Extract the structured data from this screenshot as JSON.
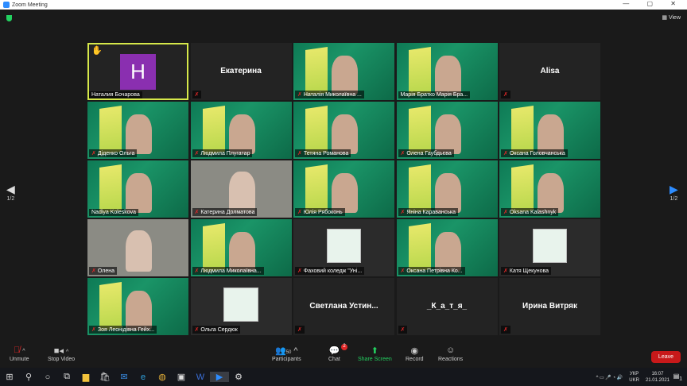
{
  "window": {
    "title": "Zoom Meeting",
    "controls": "— ▢ ✕"
  },
  "view_label": "View",
  "pager": {
    "left": "1/2",
    "right": "1/2"
  },
  "tiles": [
    {
      "name": "Наталия Бочарова",
      "type": "avatar",
      "initial": "H",
      "active": true,
      "hand": true,
      "muted": false
    },
    {
      "name": "Екатерина",
      "type": "nameonly",
      "muted": true
    },
    {
      "name": "Наталія Миколаївна ...",
      "type": "video",
      "muted": true
    },
    {
      "name": "Марія Братко Марія Бра...",
      "type": "video",
      "muted": false
    },
    {
      "name": "Alisa",
      "type": "nameonly",
      "muted": true
    },
    {
      "name": "Діденко Ольга",
      "type": "video",
      "muted": true
    },
    {
      "name": "Людмила Плугатар",
      "type": "video",
      "muted": true
    },
    {
      "name": "Тетяна Романова",
      "type": "video",
      "muted": true
    },
    {
      "name": "Олена Гаубдьєва",
      "type": "video",
      "muted": true
    },
    {
      "name": "Оксана Головчанська",
      "type": "video",
      "muted": true
    },
    {
      "name": "Nadiya Koleskova",
      "type": "video",
      "muted": false
    },
    {
      "name": "Катерина Долматова",
      "type": "gray",
      "muted": true
    },
    {
      "name": "Юлія Рябоконь",
      "type": "video",
      "muted": true
    },
    {
      "name": "Яніна Караванська",
      "type": "video",
      "muted": true
    },
    {
      "name": "Oksana Kalashnyk",
      "type": "video",
      "muted": true
    },
    {
      "name": "Олена",
      "type": "gray",
      "muted": true
    },
    {
      "name": "Людмила Миколаївна...",
      "type": "video",
      "muted": true
    },
    {
      "name": "Фаховий коледж \"Уні...",
      "type": "room",
      "muted": true
    },
    {
      "name": "Оксана Петрівна Ко...",
      "type": "video",
      "muted": true
    },
    {
      "name": "Катя Щекунова",
      "type": "room",
      "muted": true
    },
    {
      "name": "Зоя Леонідівна Гейх...",
      "type": "video",
      "muted": true
    },
    {
      "name": "Ольга Сердюк",
      "type": "room",
      "muted": true
    },
    {
      "name": "Светлана  Устин...",
      "type": "nameonly",
      "muted": true
    },
    {
      "name": "_К_а_т_я_",
      "type": "nameonly",
      "muted": true
    },
    {
      "name": "Ирина Витряк",
      "type": "nameonly",
      "muted": true
    }
  ],
  "toolbar": {
    "unmute": "Unmute",
    "stop_video": "Stop Video",
    "participants": "Participants",
    "participants_count": "50",
    "chat": "Chat",
    "chat_badge": "2",
    "share": "Share Screen",
    "record": "Record",
    "reactions": "Reactions",
    "leave": "Leave"
  },
  "taskbar": {
    "lang1": "УКР",
    "lang2": "UKR",
    "time": "16:07",
    "date": "21.01.2021",
    "notif": "1"
  }
}
